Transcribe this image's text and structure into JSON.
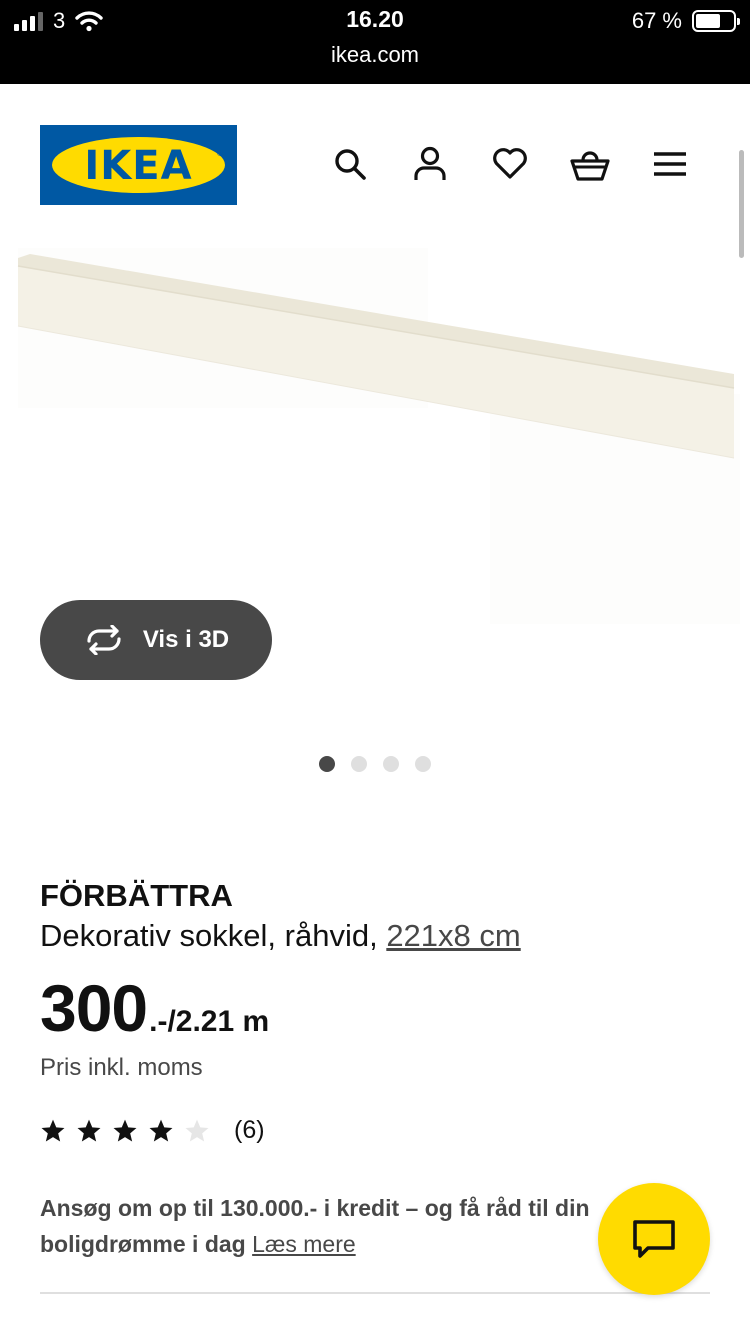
{
  "status_bar": {
    "carrier": "3",
    "time": "16.20",
    "url": "ikea.com",
    "battery_percent": "67 %",
    "battery_level": 0.67
  },
  "header": {
    "logo_text": "IKEA",
    "logo_mark": "®",
    "icons": [
      "search-icon",
      "account-icon",
      "heart-icon",
      "basket-icon",
      "menu-icon"
    ],
    "brand_blue": "#0058a3",
    "brand_yellow": "#ffdb00"
  },
  "gallery": {
    "view_3d_label": "Vis i 3D",
    "dot_count": 4,
    "active_index": 0
  },
  "product": {
    "name": "FÖRBÄTTRA",
    "description": "Dekorativ sokkel, råhvid,",
    "size_link": "221x8 cm",
    "price": "300",
    "price_unit": ".-/2.21 m",
    "vat_note": "Pris inkl. moms",
    "rating": 4,
    "rating_max": 5,
    "review_count": "(6)"
  },
  "credit": {
    "text": "Ansøg om op til 130.000.- i kredit – og få råd til din boligdrømme i dag",
    "link": "Læs mere"
  },
  "chat": {
    "icon": "chat-icon"
  }
}
